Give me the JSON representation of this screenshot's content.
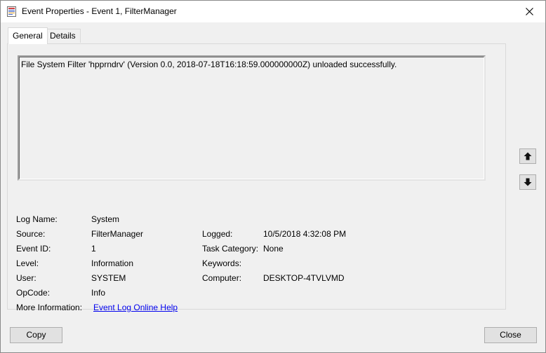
{
  "window": {
    "title": "Event Properties - Event 1, FilterManager"
  },
  "tabs": [
    {
      "label": "General",
      "selected": true
    },
    {
      "label": "Details",
      "selected": false
    }
  ],
  "message": "File System Filter 'hpprndrv' (Version 0.0, 2018-07-18T16:18:59.000000000Z) unloaded successfully.",
  "fields_left": [
    {
      "label": "Log Name:",
      "value": "System"
    },
    {
      "label": "Source:",
      "value": "FilterManager"
    },
    {
      "label": "Event ID:",
      "value": "1"
    },
    {
      "label": "Level:",
      "value": "Information"
    },
    {
      "label": "User:",
      "value": "SYSTEM"
    },
    {
      "label": "OpCode:",
      "value": "Info"
    },
    {
      "label": "More Information:",
      "value": "Event Log Online Help"
    }
  ],
  "fields_right": [
    {
      "label": "Logged:",
      "value": "10/5/2018 4:32:08 PM"
    },
    {
      "label": "Task Category:",
      "value": "None"
    },
    {
      "label": "Keywords:",
      "value": ""
    },
    {
      "label": "Computer:",
      "value": "DESKTOP-4TVLVMD"
    }
  ],
  "buttons": {
    "copy": "Copy",
    "close": "Close"
  },
  "icons": {
    "title": "event-viewer-icon",
    "close": "close-icon",
    "up": "arrow-up-icon",
    "down": "arrow-down-icon"
  },
  "colors": {
    "link": "#0000ee",
    "panel": "#f0f0f0",
    "button": "#e1e1e1"
  }
}
